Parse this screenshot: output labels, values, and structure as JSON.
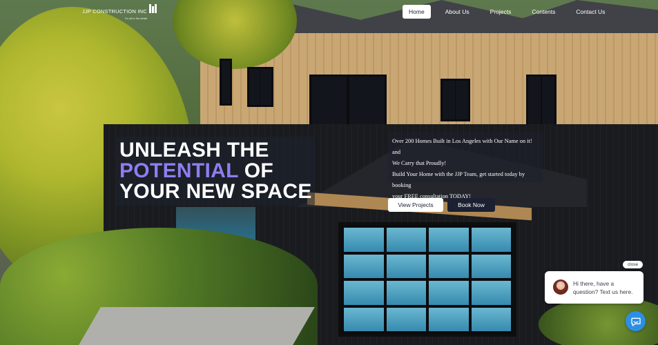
{
  "logo": {
    "name": "JJP CONSTRUCTION INC",
    "tagline": "it's all in the detail"
  },
  "nav": {
    "items": [
      {
        "label": "Home",
        "active": true
      },
      {
        "label": "About Us",
        "active": false
      },
      {
        "label": "Projects",
        "active": false
      },
      {
        "label": "Contents",
        "active": false
      },
      {
        "label": "Contact Us",
        "active": false
      }
    ]
  },
  "hero": {
    "line1": "UNLEASH THE",
    "line2_accent": "POTENTIAL",
    "line2_rest": " OF",
    "line3": "YOUR NEW SPACE",
    "info": {
      "line1": "Over 200 Homes Built in Los Angeles with Our Name on it! and",
      "line2": "We Carry that Proudly!",
      "line3": "Build Your Home with the JJP Team, get started today by booking",
      "line4": "your FREE consultation TODAY!"
    },
    "buttons": {
      "view_projects": "View Projects",
      "book_now": "Book Now"
    }
  },
  "chat": {
    "close_label": "close",
    "message": "Hi there, have a question? Text us here.",
    "fab_icon": "chat-bubble-icon"
  },
  "colors": {
    "accent": "#8f7df2",
    "dark_button": "#1b2032",
    "chat_fab": "#2d8fe3"
  }
}
